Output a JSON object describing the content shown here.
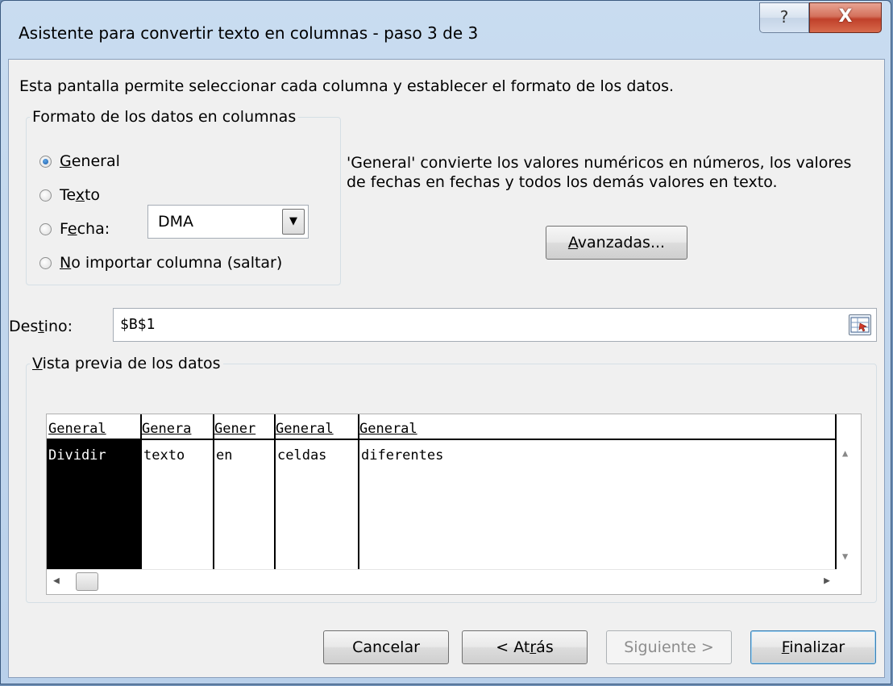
{
  "window": {
    "title": "Asistente para convertir texto en columnas - paso 3 de 3",
    "help_glyph": "?",
    "close_glyph": "X"
  },
  "description": "Esta pantalla permite seleccionar cada columna y establecer el formato de los datos.",
  "format_group": {
    "legend": "Formato de los datos en columnas",
    "options": [
      {
        "pre": "",
        "acc": "G",
        "post": "eneral",
        "checked": true
      },
      {
        "pre": "Te",
        "acc": "x",
        "post": "to",
        "checked": false
      },
      {
        "pre": "F",
        "acc": "e",
        "post": "cha:",
        "checked": false
      },
      {
        "pre": "",
        "acc": "N",
        "post": "o importar columna (saltar)",
        "checked": false
      }
    ],
    "date_format": "DMA"
  },
  "info_text": "'General' convierte los valores numéricos en números, los valores de fechas en fechas y todos los demás valores en texto.",
  "advanced_button": {
    "pre": "",
    "acc": "A",
    "post": "vanzadas..."
  },
  "destination": {
    "pre": "Des",
    "acc": "t",
    "post": "ino:",
    "value": "$B$1"
  },
  "preview_group": {
    "pre": "",
    "acc": "V",
    "post": "ista previa de los datos"
  },
  "preview": {
    "headers": [
      "General",
      "Genera",
      "Gener",
      "General",
      "General"
    ],
    "row": [
      "Dividir",
      "texto",
      "en",
      "celdas",
      "diferentes"
    ]
  },
  "buttons": {
    "cancel": {
      "label": "Cancelar"
    },
    "back": {
      "pre": "< At",
      "acc": "r",
      "post": "ás"
    },
    "next": {
      "label": "Siguiente >"
    },
    "finish": {
      "pre": "",
      "acc": "F",
      "post": "inalizar"
    }
  },
  "colors": {
    "accent_close": "#c0402a",
    "selection": "#000000",
    "dialog_bg": "#f0f0f0"
  },
  "icons": [
    "help-icon",
    "close-icon",
    "dropdown-arrow-icon",
    "range-select-icon",
    "scroll-up-icon",
    "scroll-down-icon",
    "scroll-left-icon",
    "scroll-right-icon"
  ]
}
